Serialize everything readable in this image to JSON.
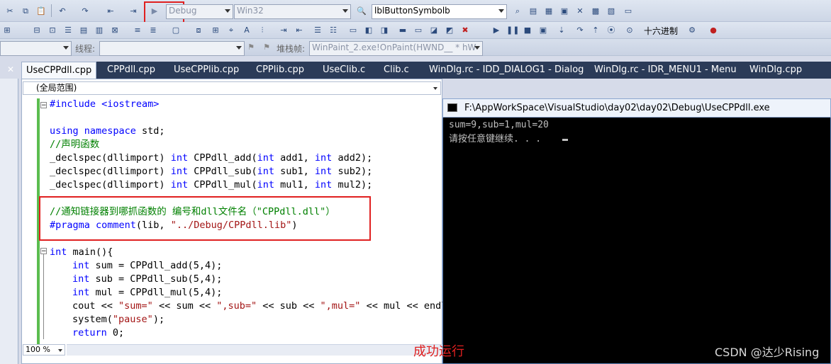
{
  "toolbar": {
    "config": "Debug",
    "platform": "Win32",
    "symbol": "lblButtonSymbolb",
    "hex_label": "十六进制",
    "thread_label": "线程:",
    "stack_label": "堆栈帧:",
    "stack_value": "WinPaint_2.exe!OnPaint(HWND__ * hW"
  },
  "tabs": [
    {
      "label": "UseCPPdll.cpp"
    },
    {
      "label": "CPPdll.cpp"
    },
    {
      "label": "UseCPPlib.cpp"
    },
    {
      "label": "CPPlib.cpp"
    },
    {
      "label": "UseClib.c"
    },
    {
      "label": "Clib.c"
    },
    {
      "label": "WinDlg.rc - IDD_DIALOG1 - Dialog"
    },
    {
      "label": "WinDlg.rc - IDR_MENU1 - Menu"
    },
    {
      "label": "WinDlg.cpp"
    }
  ],
  "editor": {
    "scope": "(全局范围)",
    "zoom": "100 %",
    "code": {
      "l1": "#include <iostream>",
      "l3a": "using",
      "l3b": " namespace",
      "l3c": " std;",
      "l4": "//声明函数",
      "l5a": "_declspec(dllimport) ",
      "l5b": "int",
      "l5c": " CPPdll_add(",
      "l5d": "int",
      "l5e": " add1, ",
      "l5f": "int",
      "l5g": " add2);",
      "l6c": " CPPdll_sub(",
      "l6e": " sub1, ",
      "l6g": " sub2);",
      "l7c": " CPPdll_mul(",
      "l7e": " mul1, ",
      "l7g": " mul2);",
      "l9": "//通知链接器到哪抓函数的 编号和dll文件名（\"CPPdll.dll\"）",
      "l10a": "#pragma comment",
      "l10b": "(lib, ",
      "l10c": "\"../Debug/CPPdll.lib\"",
      "l10d": ")",
      "l12a": "int",
      "l12b": " main(){",
      "l13b": " sum = CPPdll_add(5,4);",
      "l14b": " sub = CPPdll_sub(5,4);",
      "l15b": " mul = CPPdll_mul(5,4);",
      "l16a": "cout << ",
      "l16b": "\"sum=\"",
      "l16c": " << sum << ",
      "l16d": "\",sub=\"",
      "l16e": " << sub << ",
      "l16f": "\",mul=\"",
      "l16g": " << mul << endl",
      "l17a": "system(",
      "l17b": "\"pause\"",
      "l17c": ");",
      "l18a": "return",
      "l18b": " 0;"
    }
  },
  "console": {
    "title": "F:\\AppWorkSpace\\VisualStudio\\day02\\day02\\Debug\\UseCPPdll.exe",
    "line1": "sum=9,sub=1,mul=20",
    "line2": "请按任意键继续. . ."
  },
  "annotation": "成功运行",
  "watermark": "CSDN @达少Rising"
}
